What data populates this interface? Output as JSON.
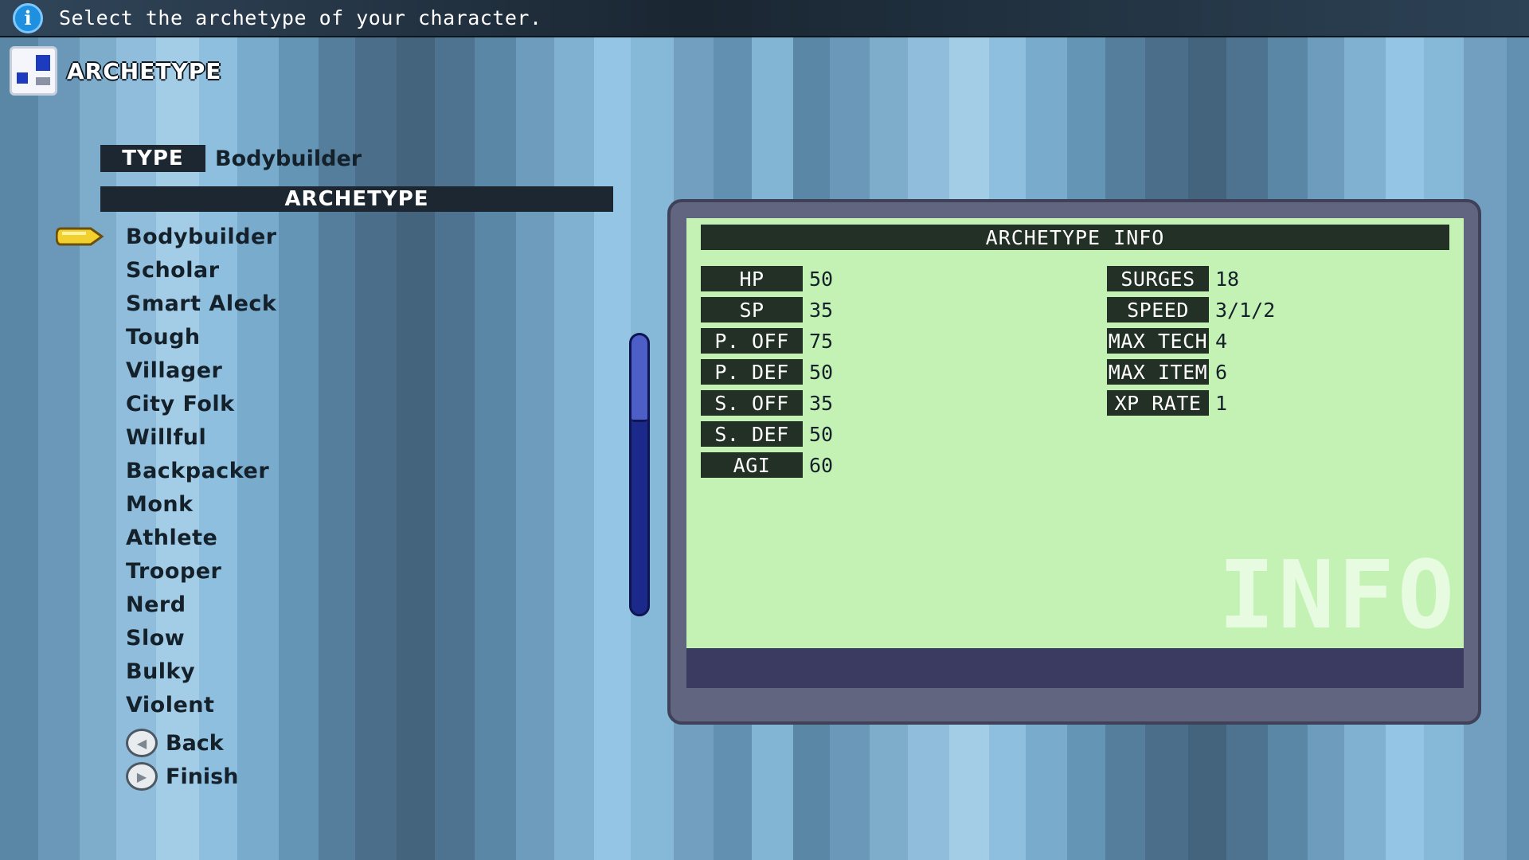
{
  "top_bar": {
    "hint": "Select the archetype of your character.",
    "icon": "info-icon"
  },
  "page": {
    "title": "ARCHETYPE",
    "icon": "archetype-icon"
  },
  "type_field": {
    "label": "TYPE",
    "value": "Bodybuilder"
  },
  "list": {
    "header": "ARCHETYPE",
    "selected_index": 0,
    "items": [
      "Bodybuilder",
      "Scholar",
      "Smart Aleck",
      "Tough",
      "Villager",
      "City Folk",
      "Willful",
      "Backpacker",
      "Monk",
      "Athlete",
      "Trooper",
      "Nerd",
      "Slow",
      "Bulky",
      "Violent"
    ]
  },
  "actions": {
    "back": "Back",
    "finish": "Finish"
  },
  "info_panel": {
    "title": "ARCHETYPE INFO",
    "stats_left": [
      {
        "label": "HP",
        "value": "50"
      },
      {
        "label": "SP",
        "value": "35"
      },
      {
        "label": "P. OFF",
        "value": "75"
      },
      {
        "label": "P. DEF",
        "value": "50"
      },
      {
        "label": "S. OFF",
        "value": "35"
      },
      {
        "label": "S. DEF",
        "value": "50"
      },
      {
        "label": "AGI",
        "value": "60"
      }
    ],
    "stats_right": [
      {
        "label": "SURGES",
        "value": "18"
      },
      {
        "label": "SPEED",
        "value": "3/1/2"
      },
      {
        "label": "MAX TECH",
        "value": "4"
      },
      {
        "label": "MAX ITEM",
        "value": "6"
      },
      {
        "label": "XP RATE",
        "value": "1"
      }
    ],
    "watermark": "INFO"
  },
  "scroll": {
    "position_fraction": 0.0,
    "visible_fraction": 0.31
  },
  "colors": {
    "panel_screen": "#c4f2b4",
    "label_dark": "#223025",
    "cursor": "#f2d12e",
    "scroll_track": "#1b2a8a"
  }
}
